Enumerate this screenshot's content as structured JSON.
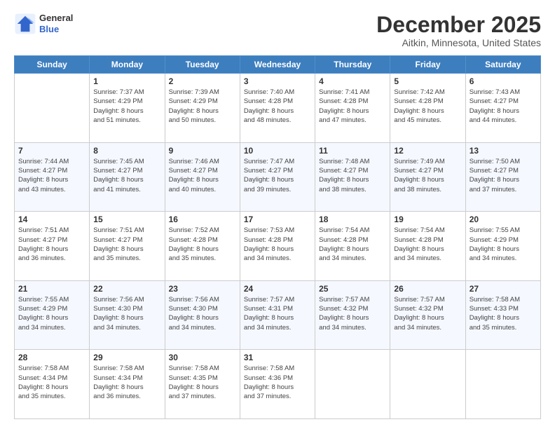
{
  "logo": {
    "general": "General",
    "blue": "Blue"
  },
  "header": {
    "month": "December 2025",
    "location": "Aitkin, Minnesota, United States"
  },
  "days": [
    "Sunday",
    "Monday",
    "Tuesday",
    "Wednesday",
    "Thursday",
    "Friday",
    "Saturday"
  ],
  "weeks": [
    [
      {
        "date": "",
        "info": ""
      },
      {
        "date": "1",
        "info": "Sunrise: 7:37 AM\nSunset: 4:29 PM\nDaylight: 8 hours\nand 51 minutes."
      },
      {
        "date": "2",
        "info": "Sunrise: 7:39 AM\nSunset: 4:29 PM\nDaylight: 8 hours\nand 50 minutes."
      },
      {
        "date": "3",
        "info": "Sunrise: 7:40 AM\nSunset: 4:28 PM\nDaylight: 8 hours\nand 48 minutes."
      },
      {
        "date": "4",
        "info": "Sunrise: 7:41 AM\nSunset: 4:28 PM\nDaylight: 8 hours\nand 47 minutes."
      },
      {
        "date": "5",
        "info": "Sunrise: 7:42 AM\nSunset: 4:28 PM\nDaylight: 8 hours\nand 45 minutes."
      },
      {
        "date": "6",
        "info": "Sunrise: 7:43 AM\nSunset: 4:27 PM\nDaylight: 8 hours\nand 44 minutes."
      }
    ],
    [
      {
        "date": "7",
        "info": "Sunrise: 7:44 AM\nSunset: 4:27 PM\nDaylight: 8 hours\nand 43 minutes."
      },
      {
        "date": "8",
        "info": "Sunrise: 7:45 AM\nSunset: 4:27 PM\nDaylight: 8 hours\nand 41 minutes."
      },
      {
        "date": "9",
        "info": "Sunrise: 7:46 AM\nSunset: 4:27 PM\nDaylight: 8 hours\nand 40 minutes."
      },
      {
        "date": "10",
        "info": "Sunrise: 7:47 AM\nSunset: 4:27 PM\nDaylight: 8 hours\nand 39 minutes."
      },
      {
        "date": "11",
        "info": "Sunrise: 7:48 AM\nSunset: 4:27 PM\nDaylight: 8 hours\nand 38 minutes."
      },
      {
        "date": "12",
        "info": "Sunrise: 7:49 AM\nSunset: 4:27 PM\nDaylight: 8 hours\nand 38 minutes."
      },
      {
        "date": "13",
        "info": "Sunrise: 7:50 AM\nSunset: 4:27 PM\nDaylight: 8 hours\nand 37 minutes."
      }
    ],
    [
      {
        "date": "14",
        "info": "Sunrise: 7:51 AM\nSunset: 4:27 PM\nDaylight: 8 hours\nand 36 minutes."
      },
      {
        "date": "15",
        "info": "Sunrise: 7:51 AM\nSunset: 4:27 PM\nDaylight: 8 hours\nand 35 minutes."
      },
      {
        "date": "16",
        "info": "Sunrise: 7:52 AM\nSunset: 4:28 PM\nDaylight: 8 hours\nand 35 minutes."
      },
      {
        "date": "17",
        "info": "Sunrise: 7:53 AM\nSunset: 4:28 PM\nDaylight: 8 hours\nand 34 minutes."
      },
      {
        "date": "18",
        "info": "Sunrise: 7:54 AM\nSunset: 4:28 PM\nDaylight: 8 hours\nand 34 minutes."
      },
      {
        "date": "19",
        "info": "Sunrise: 7:54 AM\nSunset: 4:28 PM\nDaylight: 8 hours\nand 34 minutes."
      },
      {
        "date": "20",
        "info": "Sunrise: 7:55 AM\nSunset: 4:29 PM\nDaylight: 8 hours\nand 34 minutes."
      }
    ],
    [
      {
        "date": "21",
        "info": "Sunrise: 7:55 AM\nSunset: 4:29 PM\nDaylight: 8 hours\nand 34 minutes."
      },
      {
        "date": "22",
        "info": "Sunrise: 7:56 AM\nSunset: 4:30 PM\nDaylight: 8 hours\nand 34 minutes."
      },
      {
        "date": "23",
        "info": "Sunrise: 7:56 AM\nSunset: 4:30 PM\nDaylight: 8 hours\nand 34 minutes."
      },
      {
        "date": "24",
        "info": "Sunrise: 7:57 AM\nSunset: 4:31 PM\nDaylight: 8 hours\nand 34 minutes."
      },
      {
        "date": "25",
        "info": "Sunrise: 7:57 AM\nSunset: 4:32 PM\nDaylight: 8 hours\nand 34 minutes."
      },
      {
        "date": "26",
        "info": "Sunrise: 7:57 AM\nSunset: 4:32 PM\nDaylight: 8 hours\nand 34 minutes."
      },
      {
        "date": "27",
        "info": "Sunrise: 7:58 AM\nSunset: 4:33 PM\nDaylight: 8 hours\nand 35 minutes."
      }
    ],
    [
      {
        "date": "28",
        "info": "Sunrise: 7:58 AM\nSunset: 4:34 PM\nDaylight: 8 hours\nand 35 minutes."
      },
      {
        "date": "29",
        "info": "Sunrise: 7:58 AM\nSunset: 4:34 PM\nDaylight: 8 hours\nand 36 minutes."
      },
      {
        "date": "30",
        "info": "Sunrise: 7:58 AM\nSunset: 4:35 PM\nDaylight: 8 hours\nand 37 minutes."
      },
      {
        "date": "31",
        "info": "Sunrise: 7:58 AM\nSunset: 4:36 PM\nDaylight: 8 hours\nand 37 minutes."
      },
      {
        "date": "",
        "info": ""
      },
      {
        "date": "",
        "info": ""
      },
      {
        "date": "",
        "info": ""
      }
    ]
  ]
}
